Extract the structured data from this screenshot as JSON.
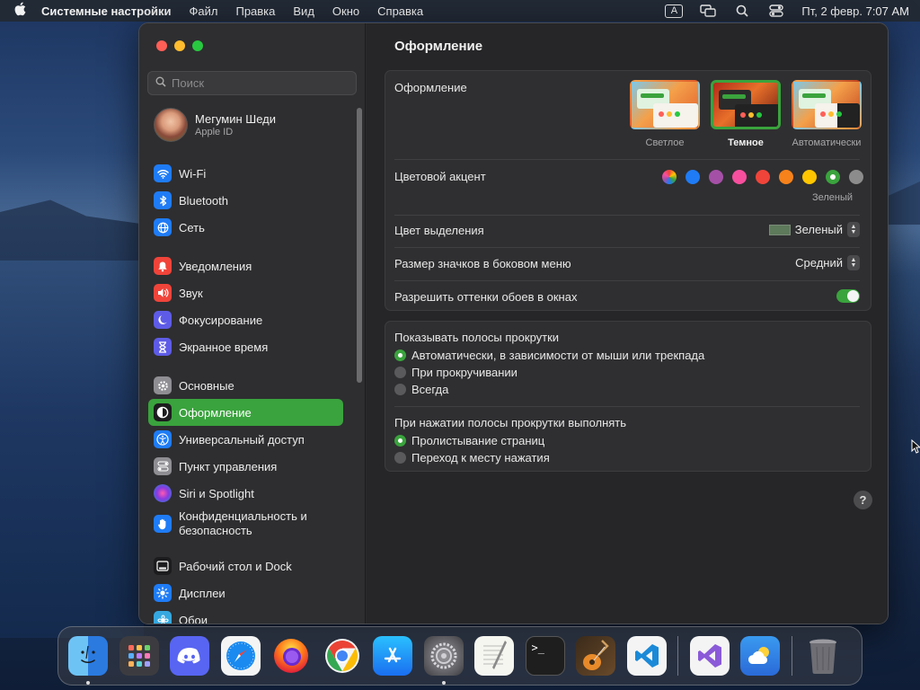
{
  "menubar": {
    "app_name": "Системные настройки",
    "items": [
      "Файл",
      "Правка",
      "Вид",
      "Окно",
      "Справка"
    ],
    "input_indicator": "A",
    "clock": "Пт, 2 февр.  7:07 AM"
  },
  "sidebar": {
    "search_placeholder": "Поиск",
    "profile": {
      "name": "Мегумин Шеди",
      "subtitle": "Apple ID"
    },
    "groups": [
      [
        {
          "label": "Wi-Fi",
          "icon": "wifi-icon",
          "color": "#1f7cf6"
        },
        {
          "label": "Bluetooth",
          "icon": "bluetooth-icon",
          "color": "#1f7cf6"
        },
        {
          "label": "Сеть",
          "icon": "globe-icon",
          "color": "#1f7cf6"
        }
      ],
      [
        {
          "label": "Уведомления",
          "icon": "bell-icon",
          "color": "#f0443a"
        },
        {
          "label": "Звук",
          "icon": "speaker-icon",
          "color": "#f0443a"
        },
        {
          "label": "Фокусирование",
          "icon": "moon-icon",
          "color": "#5e5ce6"
        },
        {
          "label": "Экранное время",
          "icon": "hourglass-icon",
          "color": "#5e5ce6"
        }
      ],
      [
        {
          "label": "Основные",
          "icon": "gear-icon",
          "color": "#8e8e93"
        },
        {
          "label": "Оформление",
          "icon": "appearance-icon",
          "color": "#1c1c1e",
          "active": true
        },
        {
          "label": "Универсальный доступ",
          "icon": "accessibility-icon",
          "color": "#1f7cf6"
        },
        {
          "label": "Пункт управления",
          "icon": "control-center-icon",
          "color": "#8e8e93"
        },
        {
          "label": "Siri и Spotlight",
          "icon": "siri-icon",
          "color": "#b03acb"
        },
        {
          "label": "Конфиденциальность и безопасность",
          "icon": "hand-icon",
          "color": "#1f7cf6"
        }
      ],
      [
        {
          "label": "Рабочий стол и Dock",
          "icon": "desktop-dock-icon",
          "color": "#1c1c1e"
        },
        {
          "label": "Дисплеи",
          "icon": "sun-icon",
          "color": "#1f7cf6"
        },
        {
          "label": "Обои",
          "icon": "wallpaper-icon",
          "color": "#36a8e0"
        }
      ]
    ]
  },
  "content": {
    "title": "Оформление",
    "appearance": {
      "label": "Оформление",
      "options": [
        {
          "label": "Светлое",
          "style": "light",
          "selected": false
        },
        {
          "label": "Темное",
          "style": "dark",
          "selected": true
        },
        {
          "label": "Автоматически",
          "style": "auto",
          "selected": false
        }
      ]
    },
    "accent": {
      "label": "Цветовой акцент",
      "colors": [
        "multicolor",
        "#1f7cf6",
        "#a550a7",
        "#f74f9e",
        "#f0443a",
        "#f7821b",
        "#ffc600",
        "#3aa33d",
        "#8c8c8c"
      ],
      "selected_index": 7,
      "selected_name": "Зеленый"
    },
    "highlight": {
      "label": "Цвет выделения",
      "value": "Зеленый",
      "swatch_color": "#5d7a5a"
    },
    "sidebar_icon_size": {
      "label": "Размер значков в боковом меню",
      "value": "Средний"
    },
    "wallpaper_tinting": {
      "label": "Разрешить оттенки обоев в окнах",
      "enabled": true
    },
    "scrollbars": {
      "label": "Показывать полосы прокрутки",
      "options": [
        {
          "label": "Автоматически, в зависимости от мыши или трекпада",
          "checked": true
        },
        {
          "label": "При прокручивании",
          "checked": false
        },
        {
          "label": "Всегда",
          "checked": false
        }
      ]
    },
    "scroll_click": {
      "label": "При нажатии полосы прокрутки выполнять",
      "options": [
        {
          "label": "Пролистывание страниц",
          "checked": true
        },
        {
          "label": "Переход к месту нажатия",
          "checked": false
        }
      ]
    },
    "help_label": "?"
  },
  "dock": {
    "apps": [
      {
        "name": "Finder",
        "icon": "finder-icon",
        "running": true
      },
      {
        "name": "Launchpad",
        "icon": "launchpad-icon",
        "running": false
      },
      {
        "name": "Discord",
        "icon": "discord-icon",
        "running": false
      },
      {
        "name": "Safari",
        "icon": "safari-icon",
        "running": false
      },
      {
        "name": "Firefox",
        "icon": "firefox-icon",
        "running": false
      },
      {
        "name": "Chrome",
        "icon": "chrome-icon",
        "running": false
      },
      {
        "name": "App Store",
        "icon": "app-store-icon",
        "running": false
      },
      {
        "name": "System Settings",
        "icon": "system-settings-icon",
        "running": true
      },
      {
        "name": "TextEdit",
        "icon": "textedit-icon",
        "running": false
      },
      {
        "name": "Terminal",
        "icon": "terminal-icon",
        "running": false
      },
      {
        "name": "GarageBand",
        "icon": "garageband-icon",
        "running": false
      },
      {
        "name": "VS Code",
        "icon": "vscode-icon",
        "running": false
      }
    ],
    "recent": [
      {
        "name": "Visual Studio",
        "icon": "visual-studio-icon"
      },
      {
        "name": "Weather",
        "icon": "weather-icon"
      }
    ],
    "trash": {
      "name": "Trash",
      "icon": "trash-icon"
    }
  },
  "colors": {
    "accent": "#3aa33d",
    "window_bg": "#262628",
    "sidebar_bg": "#2e2e30"
  }
}
